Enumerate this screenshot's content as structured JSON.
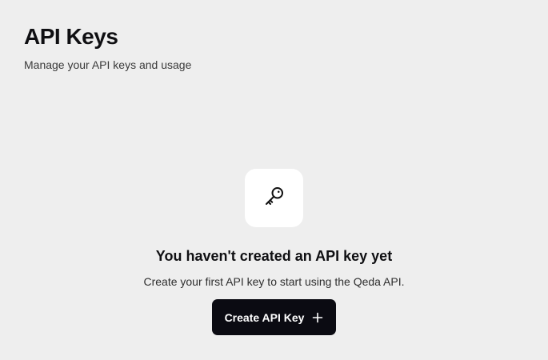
{
  "header": {
    "title": "API Keys",
    "subtitle": "Manage your API keys and usage"
  },
  "empty_state": {
    "icon": "key-icon",
    "title": "You haven't created an API key yet",
    "description": "Create your first API key to start using the Qeda API.",
    "button_label": "Create API Key",
    "button_icon": "plus-icon"
  },
  "colors": {
    "background": "#eeeeee",
    "tile": "#ffffff",
    "button": "#0b0b12",
    "button_text": "#ffffff"
  }
}
